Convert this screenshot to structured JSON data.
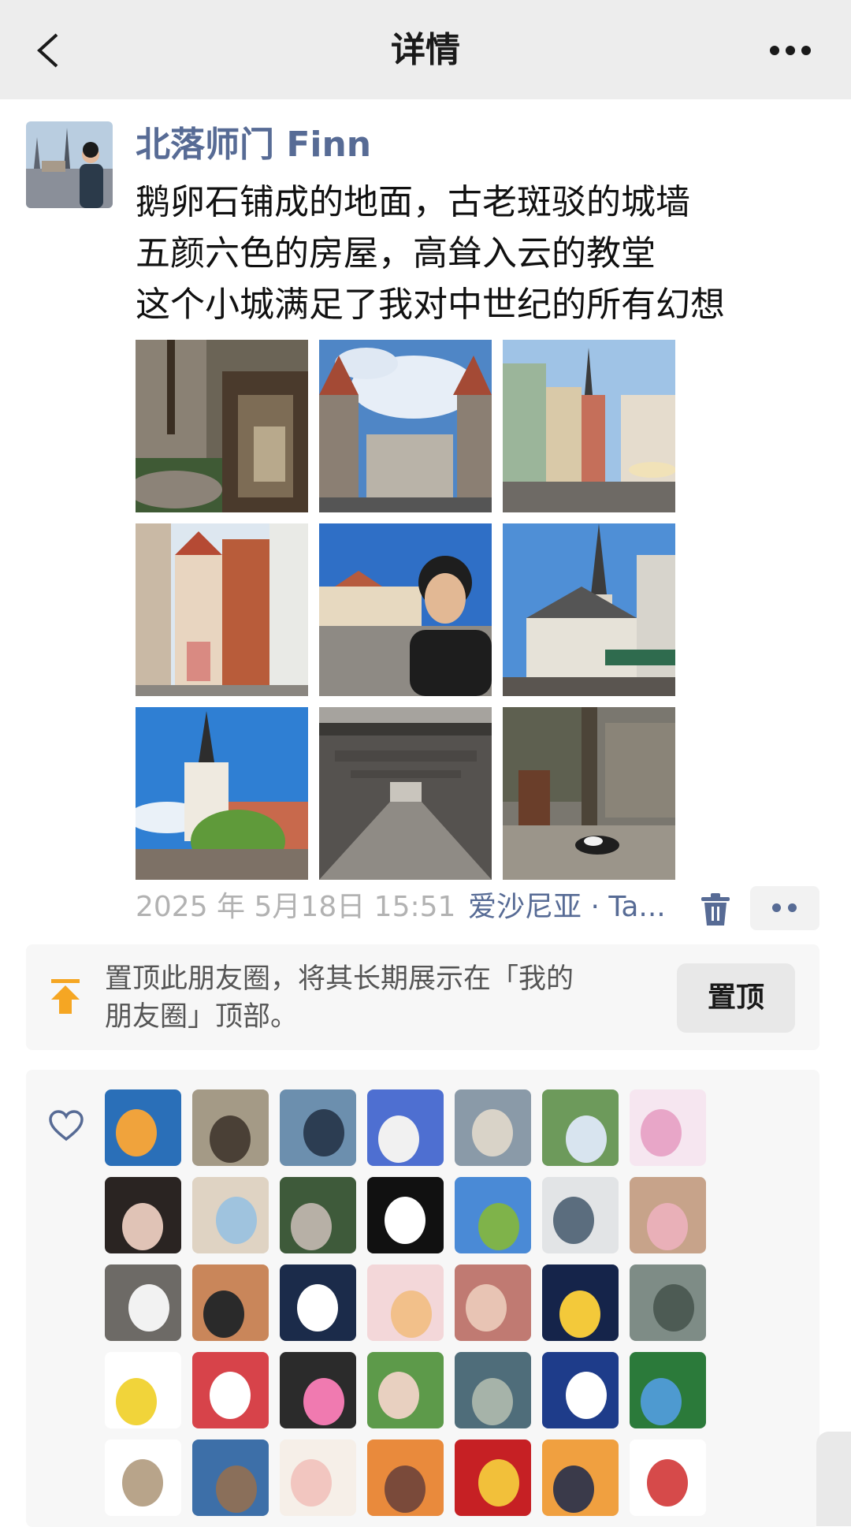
{
  "navbar": {
    "title": "详情",
    "back_icon": "chevron-left-icon",
    "more_icon": "more-dots-icon"
  },
  "post": {
    "username": "北落师门 Finn",
    "text_lines": [
      "鹅卵石铺成的地面，古老斑驳的城墙",
      "五颜六色的房屋，高耸入云的教堂",
      "这个小城满足了我对中世纪的所有幻想"
    ],
    "photo_count": 9,
    "time": "2025 年 5月18日 15:51",
    "location": "爱沙尼亚 · Ta...",
    "delete_icon": "trash-icon",
    "more_icon": "comment-dots-icon"
  },
  "pin": {
    "icon": "pin-to-top-icon",
    "line1": "置顶此朋友圈，将其长期展示在「我的",
    "line2": "朋友圈」顶部。",
    "button": "置顶"
  },
  "likes": {
    "icon": "heart-icon",
    "count_visible": 35
  },
  "colors": {
    "link": "#576b95",
    "nav_bg": "#ededed",
    "pin_icon": "#f5a623",
    "card_bg": "#f7f7f7"
  }
}
